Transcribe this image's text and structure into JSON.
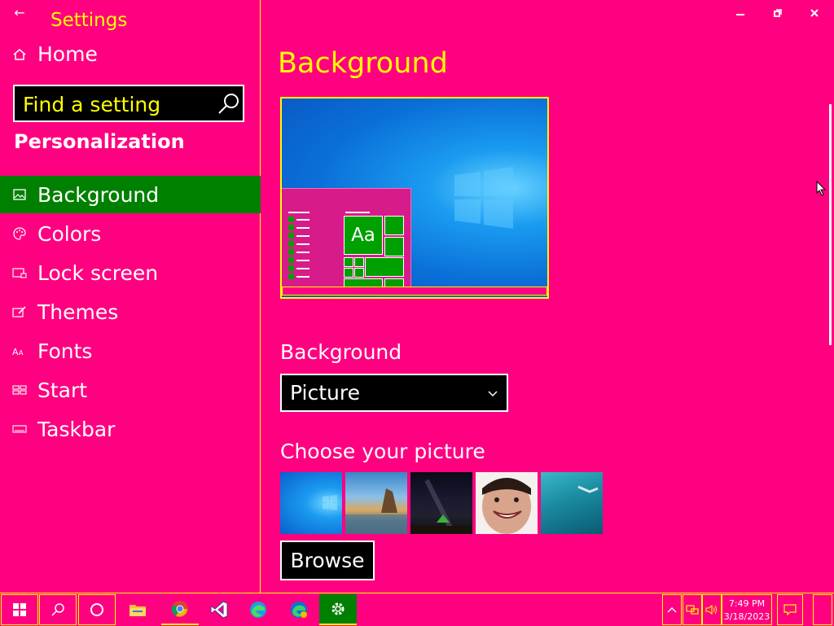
{
  "window": {
    "title": "Settings",
    "back_glyph": "←",
    "minimize_glyph": "—",
    "restore_glyph": "❐",
    "close_glyph": "✕"
  },
  "sidebar": {
    "home_label": "Home",
    "search_placeholder": "Find a setting",
    "section_title": "Personalization",
    "items": [
      {
        "label": "Background",
        "icon": "picture-icon",
        "active": true
      },
      {
        "label": "Colors",
        "icon": "palette-icon",
        "active": false
      },
      {
        "label": "Lock screen",
        "icon": "lock-screen-icon",
        "active": false
      },
      {
        "label": "Themes",
        "icon": "themes-icon",
        "active": false
      },
      {
        "label": "Fonts",
        "icon": "fonts-icon",
        "active": false
      },
      {
        "label": "Start",
        "icon": "start-icon",
        "active": false
      },
      {
        "label": "Taskbar",
        "icon": "taskbar-icon",
        "active": false
      }
    ]
  },
  "main": {
    "page_title": "Background",
    "preview_tile_text": "Aa",
    "background_label": "Background",
    "background_value": "Picture",
    "choose_label": "Choose your picture",
    "browse_label": "Browse",
    "thumbnails": [
      "windows-blue-wallpaper",
      "beach-rock-wallpaper",
      "night-sky-tent-wallpaper",
      "smiling-face-photo",
      "underwater-swimmer-wallpaper"
    ]
  },
  "taskbar": {
    "apps": [
      "start-button",
      "search-button",
      "cortana-button",
      "file-explorer",
      "chrome",
      "visual-studio",
      "edge",
      "edge-dev",
      "settings"
    ],
    "clock_time": "7:49 PM",
    "clock_date": "3/18/2023"
  },
  "colors": {
    "background": "#ff0080",
    "accent_yellow": "#ffff00",
    "active_green": "#008000"
  }
}
